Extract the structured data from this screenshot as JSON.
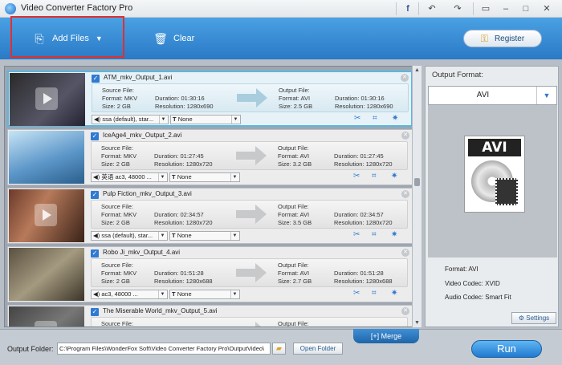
{
  "app": {
    "title": "Video Converter Factory Pro"
  },
  "titlebar": {
    "icons": [
      "facebook-icon",
      "undo-icon",
      "redo-icon",
      "chat-icon",
      "minimize-icon",
      "close-icon"
    ]
  },
  "toolbar": {
    "add_files": "Add Files",
    "clear": "Clear",
    "register": "Register"
  },
  "files": [
    {
      "name": "ATM_mkv_Output_1.avi",
      "source_label": "Source File:",
      "src_format": "Format: MKV",
      "src_duration": "Duration: 01:30:16",
      "src_size": "Size: 2 GB",
      "src_resolution": "Resolution: 1280x690",
      "output_label": "Output File:",
      "out_format": "Format: AVI",
      "out_duration": "Duration: 01:30:16",
      "out_size": "Size: 2.5 GB",
      "out_resolution": "Resolution: 1280x690",
      "audio": "ssa (default), star...",
      "subtitle": "None",
      "selected": true
    },
    {
      "name": "IceAge4_mkv_Output_2.avi",
      "source_label": "Source File:",
      "src_format": "Format: MKV",
      "src_duration": "Duration: 01:27:45",
      "src_size": "Size: 2 GB",
      "src_resolution": "Resolution: 1280x720",
      "output_label": "Output File:",
      "out_format": "Format: AVI",
      "out_duration": "Duration: 01:27:45",
      "out_size": "Size: 3.2 GB",
      "out_resolution": "Resolution: 1280x720",
      "audio": "英语  ac3, 48000 ...",
      "subtitle": "None",
      "selected": false
    },
    {
      "name": "Pulp Fiction_mkv_Output_3.avi",
      "source_label": "Source File:",
      "src_format": "Format: MKV",
      "src_duration": "Duration: 02:34:57",
      "src_size": "Size: 2 GB",
      "src_resolution": "Resolution: 1280x720",
      "output_label": "Output File:",
      "out_format": "Format: AVI",
      "out_duration": "Duration: 02:34:57",
      "out_size": "Size: 3.5 GB",
      "out_resolution": "Resolution: 1280x720",
      "audio": "ssa (default), star...",
      "subtitle": "None",
      "selected": false
    },
    {
      "name": "Robo Ji_mkv_Output_4.avi",
      "source_label": "Source File:",
      "src_format": "Format: MKV",
      "src_duration": "Duration: 01:51:28",
      "src_size": "Size: 2 GB",
      "src_resolution": "Resolution: 1280x688",
      "output_label": "Output File:",
      "out_format": "Format: AVI",
      "out_duration": "Duration: 01:51:28",
      "out_size": "Size: 2.7 GB",
      "out_resolution": "Resolution: 1280x688",
      "audio": "ac3, 48000 ...",
      "subtitle": "None",
      "selected": false
    },
    {
      "name": "The Miserable World_mkv_Output_5.avi",
      "source_label": "Source File:",
      "output_label": "Output File:",
      "selected": false
    }
  ],
  "output_panel": {
    "label": "Output Format:",
    "format": "AVI",
    "icon_label": "AVI",
    "format_info": "Format: AVI",
    "video_codec": "Video Codec: XVID",
    "audio_codec": "Audio Codec: Smart Fit",
    "settings": "Settings"
  },
  "bottom": {
    "merge": "Merge",
    "output_folder_label": "Output Folder:",
    "output_path": "C:\\Program Files\\WonderFox Soft\\Video Converter Factory Pro\\OutputVideo\\",
    "open_folder": "Open Folder",
    "run": "Run"
  }
}
